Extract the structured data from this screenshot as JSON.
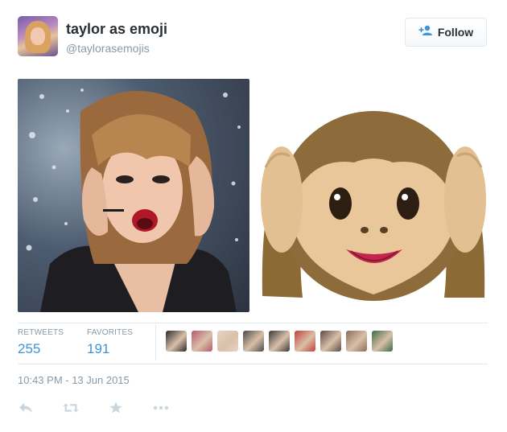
{
  "tweet": {
    "fullname": "taylor as emoji",
    "username": "@taylorasemojis",
    "follow_label": "Follow",
    "timestamp": "10:43 PM - 13 Jun 2015"
  },
  "stats": {
    "retweets_label": "RETWEETS",
    "retweets_count": "255",
    "favorites_label": "FAVORITES",
    "favorites_count": "191"
  },
  "favoriter_avatars": [
    {
      "color": "#2b2b2b"
    },
    {
      "color": "#b65a6e"
    },
    {
      "color": "#e6d2c8"
    },
    {
      "color": "#4a4a4a"
    },
    {
      "color": "#3a3a3a"
    },
    {
      "color": "#c2403a"
    },
    {
      "color": "#5a4a48"
    },
    {
      "color": "#8c6b5a"
    },
    {
      "color": "#3c6a4a"
    }
  ],
  "actions": [
    "reply-icon",
    "retweet-icon",
    "favorite-icon",
    "more-icon"
  ],
  "colors": {
    "link": "#3b94d9",
    "muted": "#8899a6",
    "text": "#292f33",
    "border": "#e1e8ed"
  }
}
